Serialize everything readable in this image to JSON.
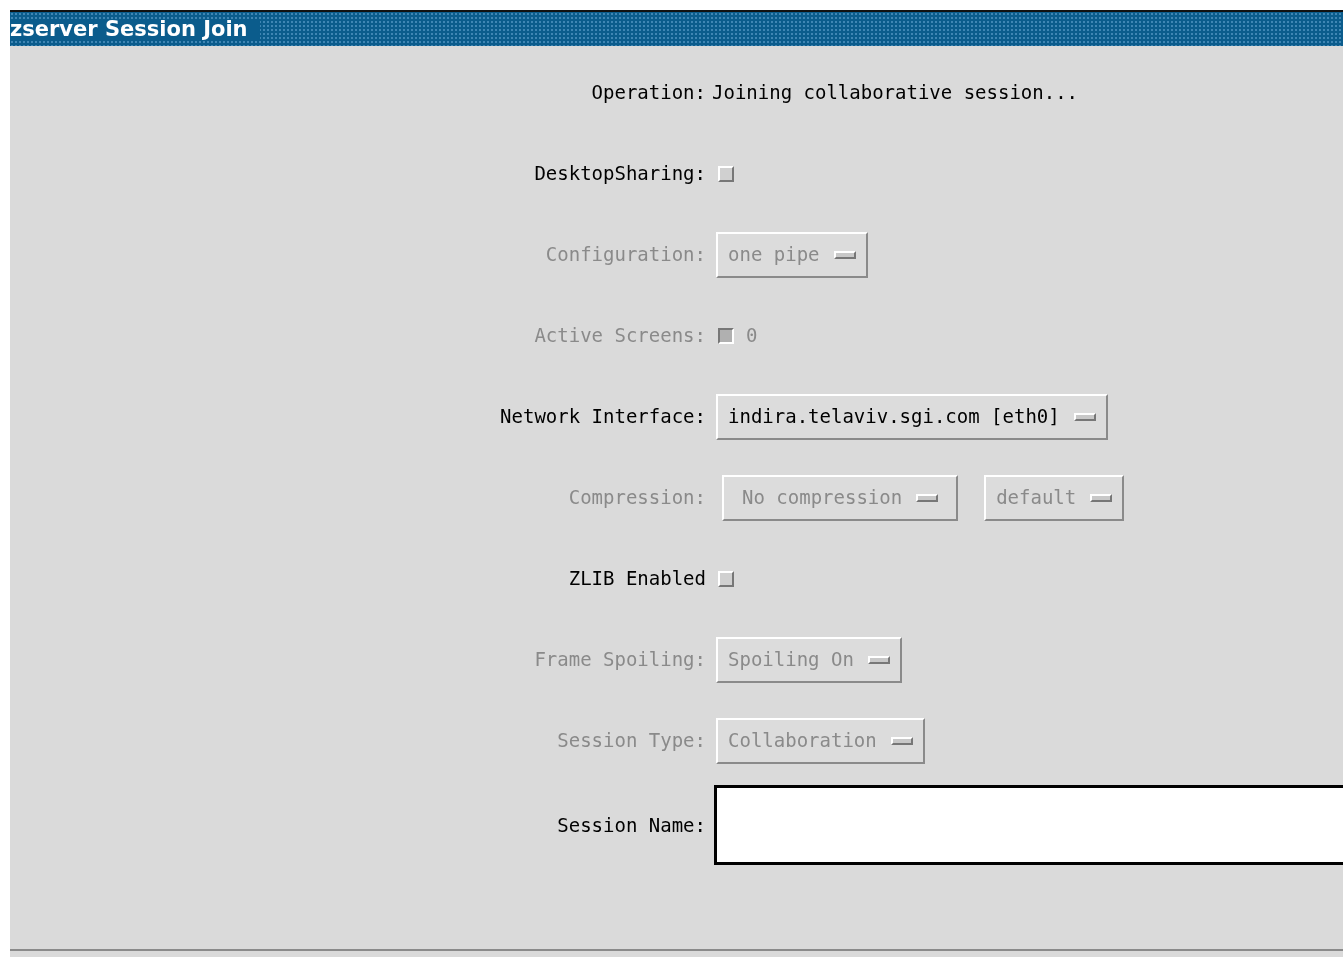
{
  "window": {
    "title": "zserver Session Join"
  },
  "rows": [
    {
      "kind": "info",
      "label": "Operation:",
      "value": "Joining collaborative session...",
      "disabled": false
    },
    {
      "kind": "checkbox",
      "label": "DesktopSharing:",
      "checked": false,
      "disabled": false
    },
    {
      "kind": "dropdown",
      "label": "Configuration:",
      "menus": [
        "one pipe"
      ],
      "disabled": true
    },
    {
      "kind": "checkbox",
      "label": "Active Screens:",
      "checked": true,
      "value": "0",
      "disabled": true
    },
    {
      "kind": "dropdown",
      "label": "Network Interface:",
      "menus": [
        "indira.telaviv.sgi.com [eth0]"
      ],
      "disabled": false
    },
    {
      "kind": "dropdown",
      "label": "Compression:",
      "menus": [
        "No compression",
        "default"
      ],
      "disabled": true
    },
    {
      "kind": "checkbox",
      "label": "ZLIB Enabled",
      "checked": false,
      "disabled": false
    },
    {
      "kind": "dropdown",
      "label": "Frame Spoiling:",
      "menus": [
        "Spoiling On"
      ],
      "disabled": true
    },
    {
      "kind": "dropdown",
      "label": "Session Type:",
      "menus": [
        "Collaboration"
      ],
      "disabled": true
    },
    {
      "kind": "text_field",
      "label": "Session Name:",
      "disabled": false
    }
  ]
}
